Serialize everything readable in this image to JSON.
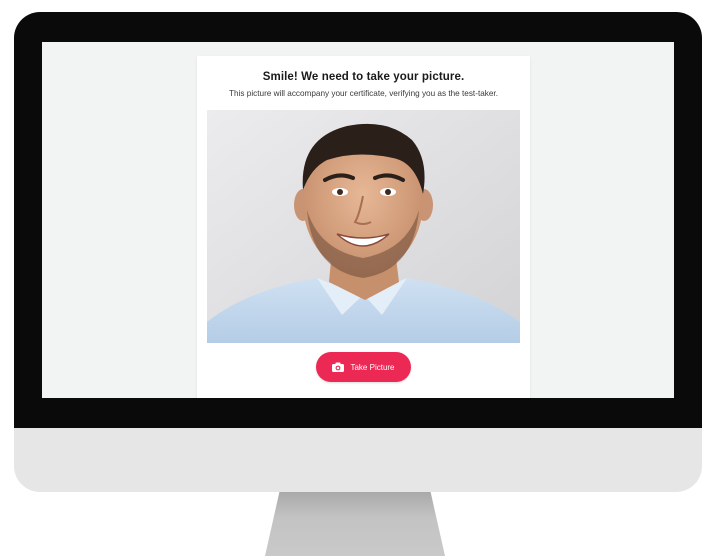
{
  "card": {
    "title": "Smile! We need to take your picture.",
    "subtitle": "This picture will accompany your certificate, verifying you as the test-taker."
  },
  "photo": {
    "icon": "portrait-photo"
  },
  "button": {
    "label": "Take Picture",
    "icon": "camera-icon",
    "color": "#ec2855"
  },
  "colors": {
    "screen_bg": "#f2f4f4",
    "bezel": "#0a0a0a",
    "chin": "#e6e6e6"
  }
}
